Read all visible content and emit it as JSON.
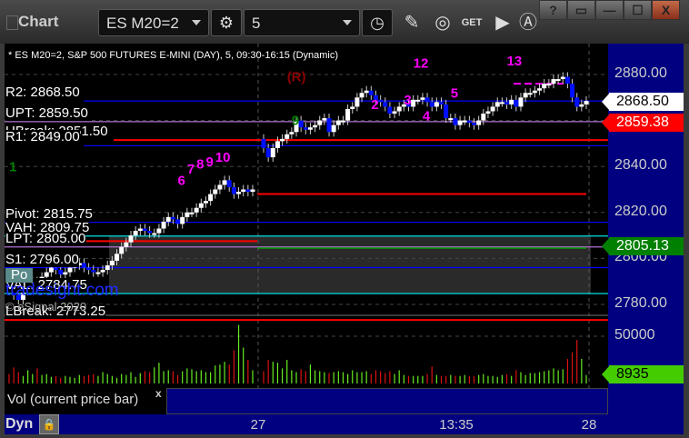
{
  "app": {
    "title": "Chart",
    "symbol": "ES M20=2",
    "interval": "5"
  },
  "icons": [
    "gear-icon",
    "clock-icon",
    "pencil-icon",
    "study-icon",
    "get-icon",
    "play-icon",
    "alert-icon",
    "help-icon",
    "restore-icon",
    "minimize-icon",
    "maximize-icon",
    "close-icon",
    "lock-icon"
  ],
  "window_buttons": [
    "?",
    "▭",
    "—",
    "☐",
    "X"
  ],
  "header": "* ES M20=2, S&P 500 FUTURES E-MINI (DAY), 5, 09:30-16:15 (Dynamic)",
  "levels": [
    {
      "label": "R2: 2868.50",
      "price": 2868.5,
      "color": "#0000ff"
    },
    {
      "label": "UPT: 2859.50",
      "price": 2859.5,
      "color": "#b070d0"
    },
    {
      "label": "UBreak: 2851.50",
      "price": 2851.5,
      "color": "#ff0000"
    },
    {
      "label": "R1: 2849.00",
      "price": 2849.0,
      "color": "#0000ff"
    },
    {
      "label": "Pivot: 2815.75",
      "price": 2815.75,
      "color": "#0000ff"
    },
    {
      "label": "VAH: 2809.75",
      "price": 2809.75,
      "color": "#00e0e0"
    },
    {
      "label": "LPT: 2805.00",
      "price": 2805.0,
      "color": "#b070d0"
    },
    {
      "label": "S1: 2796.00",
      "price": 2796.0,
      "color": "#0000ff"
    },
    {
      "label": "VAL: 2784.75",
      "price": 2784.75,
      "color": "#00e0e0"
    },
    {
      "label": "LBreak: 2773.25",
      "price": 2773.25,
      "color": "#ff0000"
    }
  ],
  "watermark": {
    "site": "tradesight.com",
    "copyright": "© eSignal 2020",
    "po": "Po"
  },
  "price_tags": {
    "last": "2868.50",
    "red": "2859.38",
    "green": "2805.13",
    "volume": "8935"
  },
  "chart_data": {
    "type": "candlestick",
    "price_axis": {
      "ticks": [
        "2880.00",
        "2860.00",
        "2840.00",
        "2820.00",
        "2800.00",
        "2780.00"
      ],
      "range": [
        2775,
        2898
      ]
    },
    "volume_axis": {
      "ticks": [
        "50000",
        "0"
      ]
    },
    "time_axis": [
      "27",
      "13:35",
      "28"
    ],
    "day1_closes": [
      2787,
      2784,
      2782,
      2786,
      2788,
      2790,
      2789,
      2792,
      2794,
      2796,
      2795,
      2793,
      2794,
      2796,
      2797,
      2798,
      2796,
      2795,
      2794,
      2794,
      2795,
      2797,
      2799,
      2802,
      2805,
      2807,
      2810,
      2812,
      2813,
      2812,
      2811,
      2811,
      2813,
      2816,
      2818,
      2817,
      2815,
      2818,
      2820,
      2820,
      2822,
      2824,
      2825,
      2828,
      2830,
      2832,
      2834,
      2831,
      2828,
      2829,
      2830,
      2829,
      2830
    ],
    "day2_closes": [
      2848,
      2844,
      2848,
      2851,
      2852,
      2854,
      2855,
      2860,
      2857,
      2856,
      2857,
      2858,
      2860,
      2861,
      2855,
      2858,
      2860,
      2860,
      2865,
      2866,
      2870,
      2872,
      2873,
      2871,
      2869,
      2868,
      2866,
      2863,
      2864,
      2866,
      2867,
      2866,
      2869,
      2869,
      2870,
      2868,
      2866,
      2868,
      2867,
      2861,
      2861,
      2858,
      2860,
      2860,
      2859,
      2858,
      2860,
      2863,
      2864,
      2866,
      2868,
      2868,
      2867,
      2869,
      2866,
      2870,
      2872,
      2872,
      2873,
      2874,
      2876,
      2876,
      2878,
      2878,
      2879,
      2876,
      2870,
      2866,
      2867,
      2868.5
    ],
    "volume": [
      10000,
      17000,
      12000,
      8000,
      14000,
      10000,
      16000,
      9000,
      10000,
      7000,
      8000,
      6000,
      8000,
      7000,
      6000,
      9000,
      8000,
      9000,
      10000,
      8000,
      12000,
      10000,
      8000,
      6000,
      10000,
      9000,
      12000,
      7000,
      11000,
      13000,
      12000,
      17000,
      22000,
      13000,
      14000,
      13000,
      9000,
      13000,
      16000,
      15000,
      13000,
      14000,
      12000,
      12000,
      19000,
      20000,
      23000,
      20000,
      35000,
      62000,
      38000,
      25000,
      14000,
      13000,
      25000,
      23000,
      22000,
      16000,
      25000,
      14000,
      12000,
      15000,
      13000,
      20000,
      14000,
      13000,
      12000,
      11000,
      12000,
      13000,
      12000,
      10000,
      14000,
      12000,
      12000,
      13000,
      10000,
      14000,
      13000,
      11000,
      13000,
      10000,
      14000,
      9000,
      8000,
      8000,
      8000,
      8000,
      10000,
      18000,
      9000,
      8000,
      8000,
      9000,
      8000,
      8000,
      9000,
      8000,
      8000,
      9000,
      10000,
      8000,
      8000,
      7000,
      9000,
      10000,
      8000,
      14000,
      12000,
      9000,
      11000,
      11000,
      12000,
      13000,
      14000,
      16000,
      14000,
      15000,
      26000,
      33000,
      46000,
      26000,
      8935
    ],
    "annotations": [
      {
        "text": "2",
        "price": 2865,
        "bar": 23,
        "color": "#ff00ff"
      },
      {
        "text": "3",
        "price": 2867,
        "bar": 30,
        "color": "#ff00ff"
      },
      {
        "text": "4",
        "price": 2860,
        "bar": 34,
        "color": "#ff00ff"
      },
      {
        "text": "5",
        "price": 2870,
        "bar": 40,
        "color": "#ff00ff"
      },
      {
        "text": "6",
        "price": 2832,
        "bar": 36,
        "color": "#ff00ff"
      },
      {
        "text": "7",
        "price": 2837,
        "bar": 38,
        "color": "#ff00ff"
      },
      {
        "text": "8",
        "price": 2839,
        "bar": 40,
        "color": "#ff00ff"
      },
      {
        "text": "9",
        "price": 2840,
        "bar": 42,
        "color": "#ff00ff"
      },
      {
        "text": "10",
        "price": 2842,
        "bar": 44,
        "color": "#ff00ff"
      },
      {
        "text": "12",
        "price": 2883,
        "bar": 32,
        "color": "#ff00ff"
      },
      {
        "text": "13",
        "price": 2884,
        "bar": 52,
        "color": "#ff00ff"
      },
      {
        "text": "(R)",
        "price": 2877,
        "bar": 5,
        "color": "#8b0000"
      },
      {
        "text": "1",
        "price": 2838,
        "bar": 0,
        "color": "#008000"
      },
      {
        "text": "9",
        "price": 2858,
        "bar": 6,
        "color": "#008000"
      }
    ]
  },
  "volume_pane": {
    "label": "Vol (current price bar)",
    "close": "x"
  },
  "footer": {
    "mode": "Dyn"
  }
}
